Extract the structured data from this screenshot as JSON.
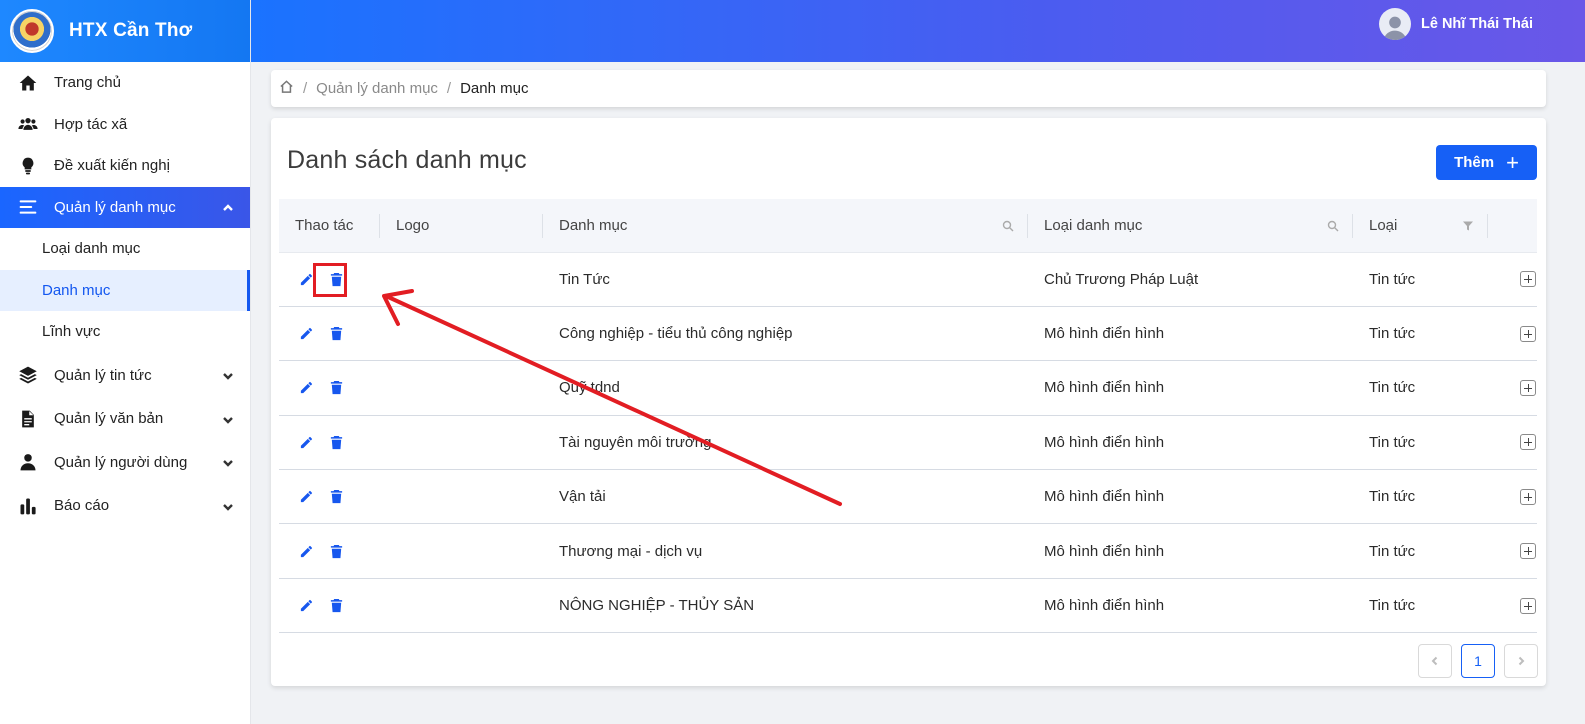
{
  "brand": {
    "title": "HTX Cần Thơ"
  },
  "user": {
    "name": "Lê Nhĩ Thái Thái"
  },
  "sidebar": {
    "items": [
      {
        "label": "Trang chủ",
        "icon": "home-icon"
      },
      {
        "label": "Hợp tác xã",
        "icon": "users-icon"
      },
      {
        "label": "Đề xuất kiến nghị",
        "icon": "lightbulb-icon"
      },
      {
        "label": "Quản lý danh mục",
        "icon": "menu-icon",
        "expanded": true
      },
      {
        "label": "Quản lý tin tức",
        "icon": "layers-icon"
      },
      {
        "label": "Quản lý văn bản",
        "icon": "document-icon"
      },
      {
        "label": "Quản lý người dùng",
        "icon": "user-icon"
      },
      {
        "label": "Báo cáo",
        "icon": "bar-chart-icon"
      }
    ],
    "sub_items": [
      {
        "label": "Loại danh mục"
      },
      {
        "label": "Danh mục",
        "current": true
      },
      {
        "label": "Lĩnh vực"
      }
    ]
  },
  "breadcrumb": {
    "parent": "Quản lý danh mục",
    "current": "Danh mục",
    "separator": "/"
  },
  "main": {
    "title": "Danh sách danh mục",
    "add_button": "Thêm",
    "columns": [
      "Thao tác",
      "Logo",
      "Danh mục",
      "Loại danh mục",
      "Loại"
    ],
    "rows": [
      {
        "danh_muc": "Tin Tức",
        "loai_danh_muc": "Chủ Trương Pháp Luật",
        "loai": "Tin tức"
      },
      {
        "danh_muc": "Công nghiệp - tiểu thủ công nghiệp",
        "loai_danh_muc": "Mô hình điển hình",
        "loai": "Tin tức"
      },
      {
        "danh_muc": "Quỹ tdnd",
        "loai_danh_muc": "Mô hình điển hình",
        "loai": "Tin tức"
      },
      {
        "danh_muc": "Tài nguyên môi trường",
        "loai_danh_muc": "Mô hình điển hình",
        "loai": "Tin tức"
      },
      {
        "danh_muc": "Vận tải",
        "loai_danh_muc": "Mô hình điển hình",
        "loai": "Tin tức"
      },
      {
        "danh_muc": "Thương mại - dịch vụ",
        "loai_danh_muc": "Mô hình điển hình",
        "loai": "Tin tức"
      },
      {
        "danh_muc": "NÔNG NGHIỆP - THỦY SẢN",
        "loai_danh_muc": "Mô hình điển hình",
        "loai": "Tin tức"
      }
    ]
  },
  "pagination": {
    "current_page": "1"
  },
  "colors": {
    "primary": "#1660f6",
    "annotation": "#e21d23"
  }
}
